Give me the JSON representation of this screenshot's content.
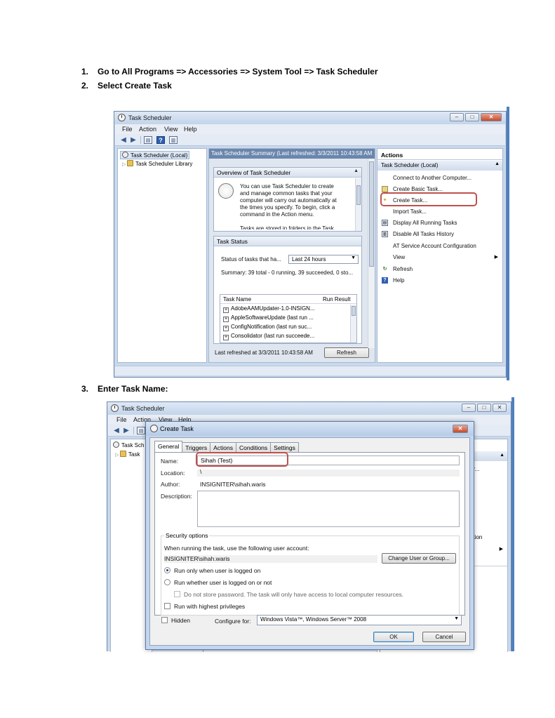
{
  "steps": [
    {
      "number": "1.",
      "text": "Go to All Programs => Accessories => System Tool => Task Scheduler"
    },
    {
      "number": "2.",
      "text": "Select Create Task"
    },
    {
      "number": "3.",
      "text": "Enter Task Name:"
    }
  ],
  "window1": {
    "title": "Task Scheduler",
    "menu": [
      "File",
      "Action",
      "View",
      "Help"
    ],
    "tree": {
      "root": "Task Scheduler (Local)",
      "child": "Task Scheduler Library"
    },
    "summary_header": "Task Scheduler Summary (Last refreshed: 3/3/2011 10:43:58 AM",
    "overview": {
      "title": "Overview of Task Scheduler",
      "lines": [
        "You can use Task Scheduler to create",
        "and manage common tasks that your",
        "computer will carry out automatically at",
        "the times you specify. To begin, click a",
        "command in the Action menu.",
        "Tasks are stored in folders in the Task"
      ]
    },
    "task_status": {
      "title": "Task Status",
      "status_label": "Status of tasks that ha...",
      "range_value": "Last 24 hours",
      "summary": "Summary: 39 total - 0 running, 39 succeeded, 0 sto...",
      "col_name": "Task Name",
      "col_result": "Run Result",
      "rows": [
        "AdobeAAMUpdater-1.0-INSIGN...",
        "AppleSoftwareUpdate (last run ...",
        "ConfigNotification (last run suc...",
        "Consolidator (last run succeede..."
      ],
      "last_refreshed": "Last refreshed at 3/3/2011 10:43:58 AM",
      "refresh_button": "Refresh"
    },
    "actions": {
      "title": "Actions",
      "section": "Task Scheduler (Local)",
      "items": [
        "Connect to Another Computer...",
        "Create Basic Task...",
        "Create Task...",
        "Import Task...",
        "Display All Running Tasks",
        "Disable All Tasks History",
        "AT Service Account Configuration",
        "View",
        "Refresh",
        "Help"
      ]
    }
  },
  "window2": {
    "title": "Task Scheduler",
    "menu": [
      "File",
      "Action",
      "View",
      "Help"
    ],
    "tree_root": "Task Sch",
    "tree_child": "Task",
    "right_fragments": [
      "er...",
      "ation"
    ],
    "dialog": {
      "title": "Create Task",
      "tabs": [
        "General",
        "Triggers",
        "Actions",
        "Conditions",
        "Settings"
      ],
      "name_label": "Name:",
      "name_value": "Sihah (Test)",
      "location_label": "Location:",
      "location_value": "\\",
      "author_label": "Author:",
      "author_value": "INSIGNITER\\sihah.waris",
      "description_label": "Description:",
      "security_legend": "Security options",
      "account_prompt": "When running the task, use the following user account:",
      "account_value": "INSIGNITER\\sihah.waris",
      "change_user_button": "Change User or Group...",
      "radio_logged_on": "Run only when user is logged on",
      "radio_whether": "Run whether user is logged on or not",
      "no_store_password": "Do not store password.  The task will only have access to local computer resources.",
      "highest_privileges": "Run with highest privileges",
      "hidden_label": "Hidden",
      "configure_label": "Configure for:",
      "configure_value": "Windows Vista™, Windows Server™ 2008",
      "ok_button": "OK",
      "cancel_button": "Cancel"
    }
  }
}
